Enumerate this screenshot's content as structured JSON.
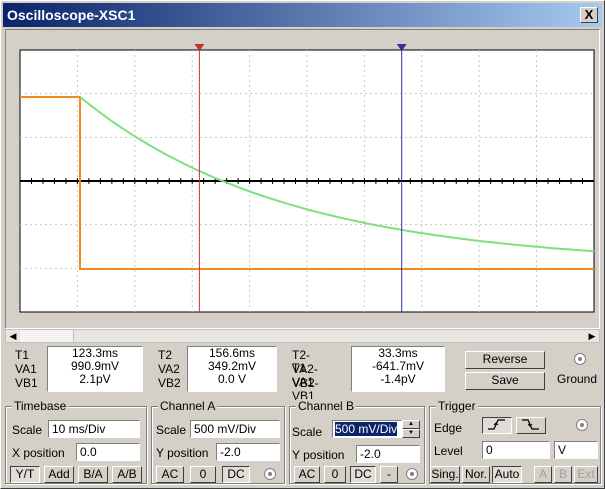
{
  "window": {
    "title": "Oscilloscope-XSC1",
    "close_label": "X"
  },
  "colors": {
    "channel_a": "#f08a1c",
    "channel_b": "#7ee07e",
    "cursor1": "#c83030",
    "cursor2": "#3030a0",
    "title_start": "#0a246a",
    "title_end": "#a6caf0"
  },
  "cursors": {
    "t1_pct": 0.3125,
    "t2_pct": 0.665
  },
  "readouts": {
    "t1": {
      "labels": [
        "T1",
        "VA1",
        "VB1"
      ],
      "values": [
        "123.3ms",
        "990.9mV",
        "2.1pV"
      ]
    },
    "t2": {
      "labels": [
        "T2",
        "VA2",
        "VB2"
      ],
      "values": [
        "156.6ms",
        "349.2mV",
        "0.0 V"
      ]
    },
    "diff": {
      "labels": [
        "T2-T1",
        "VA2-VA1",
        "VB2-VB1"
      ],
      "values": [
        "33.3ms",
        "-641.7mV",
        "-1.4pV"
      ]
    }
  },
  "buttons": {
    "reverse": "Reverse",
    "save": "Save",
    "ground": "Ground"
  },
  "timebase": {
    "title": "Timebase",
    "scale_label": "Scale",
    "scale_value": "10 ms/Div",
    "xpos_label": "X position",
    "xpos_value": "0.0",
    "modes": [
      "Y/T",
      "Add",
      "B/A",
      "A/B"
    ]
  },
  "channel_a": {
    "title": "Channel A",
    "scale_label": "Scale",
    "scale_value": "500 mV/Div",
    "ypos_label": "Y position",
    "ypos_value": "-2.0",
    "coupling": [
      "AC",
      "0",
      "DC"
    ]
  },
  "channel_b": {
    "title": "Channel B",
    "scale_label": "Scale",
    "scale_value": "500 mV/Div",
    "ypos_label": "Y position",
    "ypos_value": "-2.0",
    "coupling": [
      "AC",
      "0",
      "DC",
      "-"
    ]
  },
  "trigger": {
    "title": "Trigger",
    "edge_label": "Edge",
    "level_label": "Level",
    "level_value": "0",
    "level_unit": "V",
    "modes": [
      "Sing.",
      "Nor.",
      "Auto"
    ],
    "sources": [
      "A",
      "B",
      "Ext"
    ]
  }
}
